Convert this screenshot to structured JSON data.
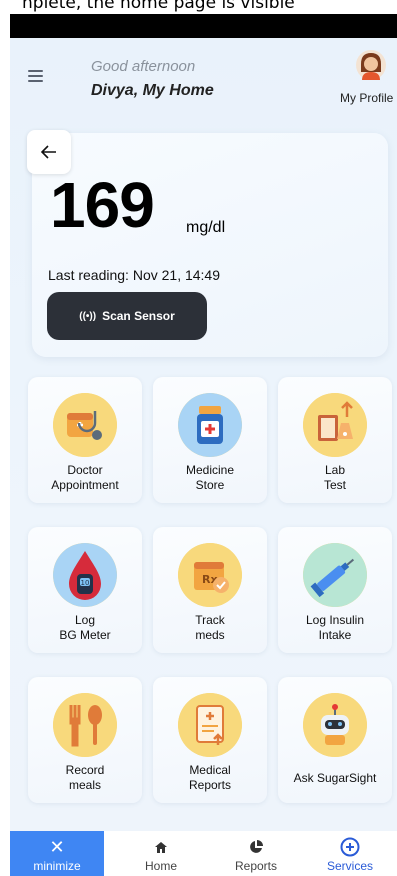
{
  "top_caption": "nplete, the home page is visible",
  "header": {
    "greeting": "Good afternoon",
    "home_title": "Divya, My Home",
    "profile_label": "My Profile"
  },
  "reading": {
    "value": "169",
    "unit": "mg/dl",
    "last_reading": "Last reading: Nov 21, 14:49",
    "scan_button": "Scan Sensor"
  },
  "tiles": [
    {
      "label": "Doctor\nAppointment",
      "icon": "doctor-appointment-icon"
    },
    {
      "label": "Medicine\nStore",
      "icon": "medicine-store-icon"
    },
    {
      "label": "Lab\nTest",
      "icon": "lab-test-icon"
    },
    {
      "label": "Log\nBG Meter",
      "icon": "bg-meter-icon"
    },
    {
      "label": "Track\nmeds",
      "icon": "track-meds-icon"
    },
    {
      "label": "Log Insulin\nIntake",
      "icon": "insulin-syringe-icon"
    },
    {
      "label": "Record\nmeals",
      "icon": "meals-icon"
    },
    {
      "label": "Medical\nReports",
      "icon": "medical-reports-icon"
    },
    {
      "label": "Ask SugarSight",
      "icon": "robot-assistant-icon"
    }
  ],
  "nav": {
    "minimize": "minimize",
    "home": "Home",
    "reports": "Reports",
    "services": "Services"
  },
  "colors": {
    "accent": "#3f86f3",
    "services_active": "#2a5bd7",
    "scan_button_bg": "#2c3038",
    "tile_icon_bg": "#f8d97c"
  }
}
